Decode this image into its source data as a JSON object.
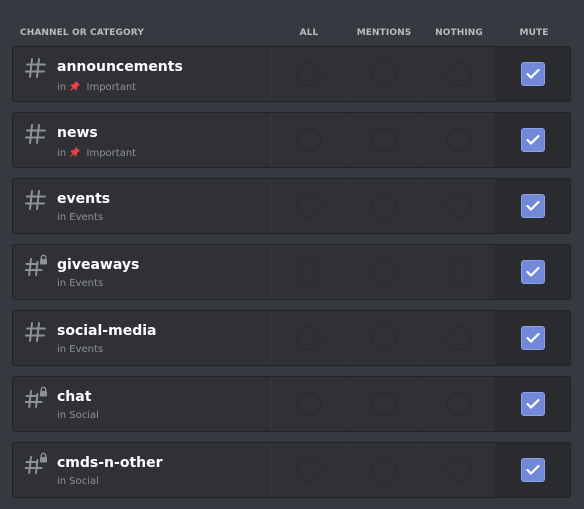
{
  "header": {
    "channel_or_category": "CHANNEL OR CATEGORY",
    "all": "ALL",
    "mentions": "MENTIONS",
    "nothing": "NOTHING",
    "mute": "MUTE"
  },
  "colors": {
    "background": "#36393f",
    "row_background": "#2f3136",
    "mute_cell_background": "#292b2f",
    "checkbox_accent": "#7289da",
    "pin_red": "#ed4245"
  },
  "rows": [
    {
      "name": "announcements",
      "sub_prefix": "in",
      "category": "Important",
      "icon": "hashtag-icon",
      "pinned": true,
      "muted": true
    },
    {
      "name": "news",
      "sub_prefix": "in",
      "category": "Important",
      "icon": "hashtag-icon",
      "pinned": true,
      "muted": true
    },
    {
      "name": "events",
      "sub_prefix": "in Events",
      "category": "",
      "icon": "hashtag-icon",
      "pinned": false,
      "muted": true
    },
    {
      "name": "giveaways",
      "sub_prefix": "in Events",
      "category": "",
      "icon": "locked-hashtag-icon",
      "pinned": false,
      "muted": true
    },
    {
      "name": "social-media",
      "sub_prefix": "in Events",
      "category": "",
      "icon": "hashtag-icon",
      "pinned": false,
      "muted": true
    },
    {
      "name": "chat",
      "sub_prefix": "in Social",
      "category": "",
      "icon": "locked-hashtag-icon",
      "pinned": false,
      "muted": true
    },
    {
      "name": "cmds-n-other",
      "sub_prefix": "in Social",
      "category": "",
      "icon": "locked-hashtag-icon",
      "pinned": false,
      "muted": true
    }
  ]
}
